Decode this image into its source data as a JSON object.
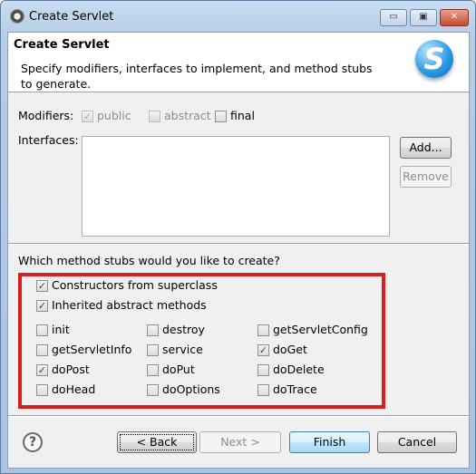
{
  "window": {
    "title": "Create Servlet",
    "minimize": "▭",
    "maximize": "▣",
    "close": "✕"
  },
  "header": {
    "title": "Create Servlet",
    "description": "Specify modifiers, interfaces to implement, and method stubs to generate.",
    "logo_letter": "S"
  },
  "modifiers": {
    "label": "Modifiers:",
    "options": [
      {
        "label": "public",
        "checked": true,
        "enabled": false
      },
      {
        "label": "abstract",
        "checked": false,
        "enabled": false
      },
      {
        "label": "final",
        "checked": false,
        "enabled": true
      }
    ]
  },
  "interfaces": {
    "label": "Interfaces:",
    "items": [],
    "add": "Add...",
    "remove": "Remove"
  },
  "stubs": {
    "question": "Which method stubs would you like to create?",
    "general": [
      {
        "label": "Constructors from superclass",
        "checked": true
      },
      {
        "label": "Inherited abstract methods",
        "checked": true
      }
    ],
    "methods": [
      {
        "label": "init",
        "checked": false
      },
      {
        "label": "destroy",
        "checked": false
      },
      {
        "label": "getServletConfig",
        "checked": false
      },
      {
        "label": "getServletInfo",
        "checked": false
      },
      {
        "label": "service",
        "checked": false
      },
      {
        "label": "doGet",
        "checked": true
      },
      {
        "label": "doPost",
        "checked": true
      },
      {
        "label": "doPut",
        "checked": false
      },
      {
        "label": "doDelete",
        "checked": false
      },
      {
        "label": "doHead",
        "checked": false
      },
      {
        "label": "doOptions",
        "checked": false
      },
      {
        "label": "doTrace",
        "checked": false
      }
    ]
  },
  "footer": {
    "help": "?",
    "back": "< Back",
    "next": "Next >",
    "finish": "Finish",
    "cancel": "Cancel"
  },
  "colors": {
    "highlight_box": "#d42020"
  }
}
